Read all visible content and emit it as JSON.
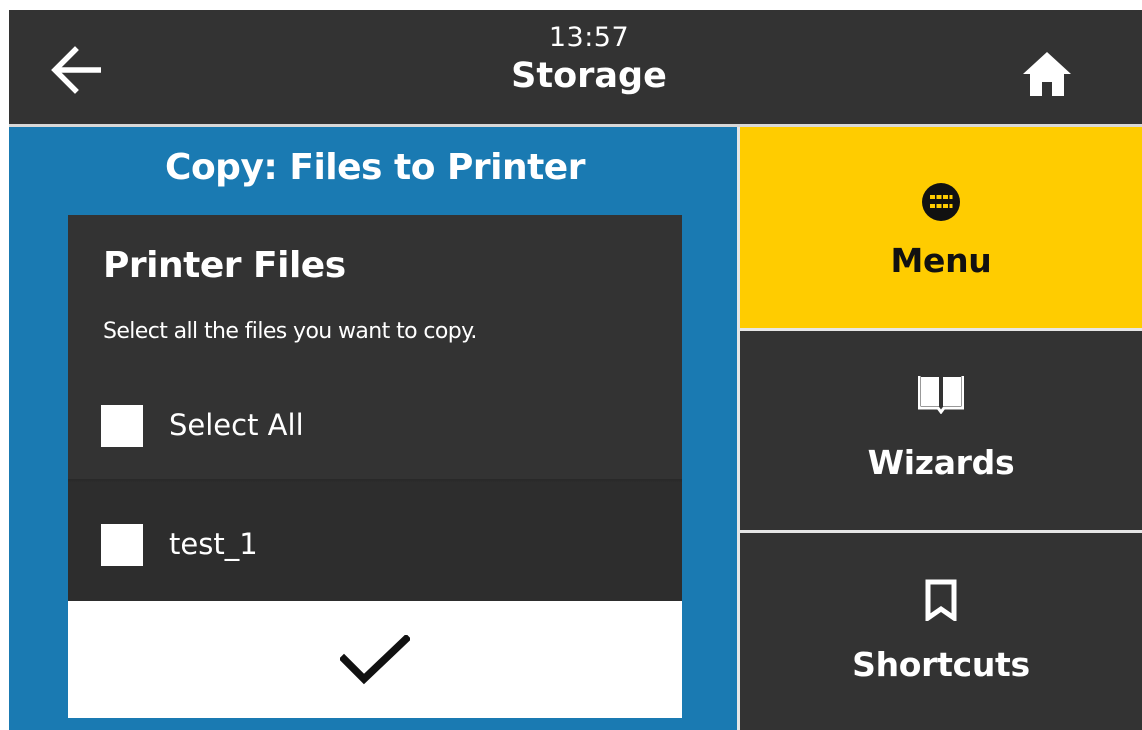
{
  "header": {
    "time": "13:57",
    "title": "Storage",
    "back_icon": "arrow-left-icon",
    "home_icon": "home-icon"
  },
  "panel": {
    "title": "Copy: Files to Printer",
    "dialog": {
      "heading": "Printer Files",
      "instructions": "Select all the files you want to copy.",
      "select_all_label": "Select All",
      "files": [
        {
          "name": "test_1",
          "checked": false
        }
      ],
      "confirm_icon": "checkmark-icon"
    }
  },
  "nav": {
    "items": [
      {
        "label": "Menu",
        "icon": "grid-dots-icon",
        "active": true
      },
      {
        "label": "Wizards",
        "icon": "book-icon",
        "active": false
      },
      {
        "label": "Shortcuts",
        "icon": "bookmark-icon",
        "active": false
      }
    ]
  },
  "colors": {
    "background": "#333333",
    "panel_blue": "#1a7ab2",
    "active_yellow": "#ffcc00",
    "text_white": "#ffffff"
  }
}
